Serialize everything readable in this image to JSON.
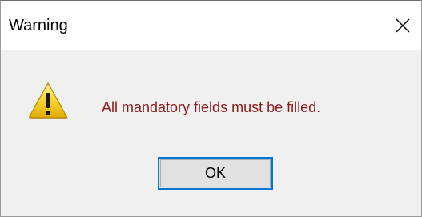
{
  "window": {
    "title": "Warning",
    "close_icon": "close-icon"
  },
  "body": {
    "icon": "warning-icon",
    "message": "All mandatory fields must be filled.",
    "message_color": "#8b1a1a"
  },
  "buttons": {
    "ok_label": "OK"
  }
}
